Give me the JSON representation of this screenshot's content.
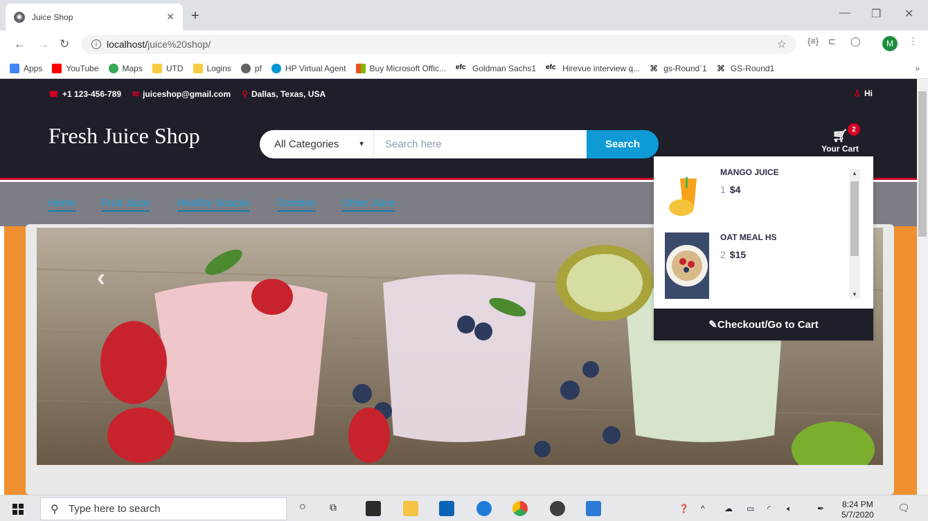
{
  "browser": {
    "tab_title": "Juice Shop",
    "url_host": "localhost/",
    "url_path": "juice%20shop/",
    "profile_initial": "M",
    "bookmarks": [
      "Apps",
      "YouTube",
      "Maps",
      "UTD",
      "Logins",
      "pf",
      "HP Virtual Agent",
      "Buy Microsoft Offic...",
      "Goldman Sachs1",
      "Hirevue interview q...",
      "gs-Round`1",
      "GS-Round1"
    ]
  },
  "site": {
    "phone": "+1 123-456-789",
    "email": "juiceshop@gmail.com",
    "location": "Dallas, Texas, USA",
    "greeting": "Hi",
    "logo": "Fresh Juice Shop",
    "category_select": "All Categories",
    "search_placeholder": "Search here",
    "search_button": "Search",
    "cart_label": "Your Cart",
    "cart_count": "2",
    "nav": [
      "Home",
      "Fruit Juice",
      "Healthy Snacks",
      "Combos",
      "Other Juice"
    ],
    "cart_items": [
      {
        "name": "MANGO JUICE",
        "qty": "1",
        "price": "$4"
      },
      {
        "name": "OAT MEAL HS",
        "qty": "2",
        "price": "$15"
      }
    ],
    "checkout_label": "Checkout/Go to Cart"
  },
  "taskbar": {
    "search_placeholder": "Type here to search",
    "time": "8:24 PM",
    "date": "5/7/2020"
  }
}
